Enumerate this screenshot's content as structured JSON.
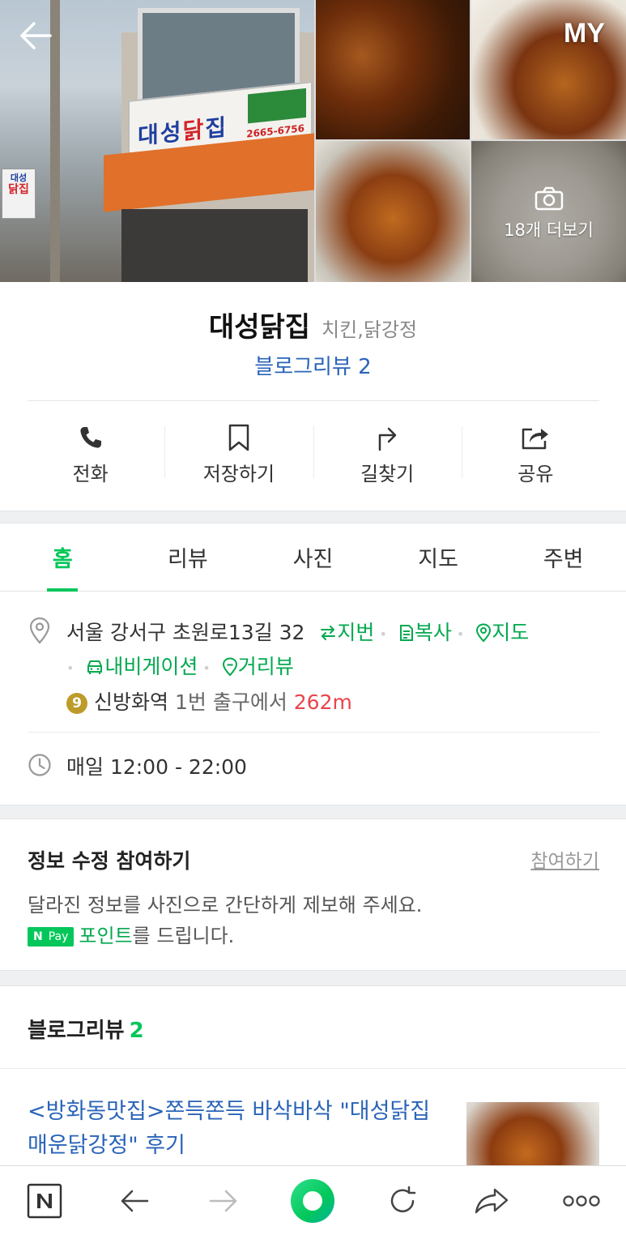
{
  "header": {
    "my_label": "MY",
    "more_photos_label": "18개 더보기"
  },
  "shop_sign": {
    "name_part1": "대성",
    "name_part2": "닭",
    "name_part3": "집",
    "phone": "2665-6756",
    "side_top": "대성",
    "side_bottom": "닭집"
  },
  "place": {
    "name": "대성닭집",
    "category": "치킨,닭강정",
    "blog_review_link": "블로그리뷰 2"
  },
  "actions": [
    {
      "label": "전화",
      "icon": "phone-icon"
    },
    {
      "label": "저장하기",
      "icon": "bookmark-icon"
    },
    {
      "label": "길찾기",
      "icon": "directions-icon"
    },
    {
      "label": "공유",
      "icon": "share-icon"
    }
  ],
  "tabs": [
    {
      "label": "홈",
      "active": true
    },
    {
      "label": "리뷰",
      "active": false
    },
    {
      "label": "사진",
      "active": false
    },
    {
      "label": "지도",
      "active": false
    },
    {
      "label": "주변",
      "active": false
    }
  ],
  "info": {
    "address": "서울 강서구 초원로13길 32",
    "lot_number_link": "지번",
    "copy_link": "복사",
    "map_link": "지도",
    "navigation_link": "내비게이션",
    "street_view_link": "거리뷰",
    "subway_line": "9",
    "subway_station": "신방화역",
    "subway_exit": "1번 출구에서",
    "subway_distance": "262m",
    "hours": "매일 12:00 - 22:00"
  },
  "edit_info": {
    "title": "정보 수정 참여하기",
    "join_link": "참여하기",
    "desc1": "달라진 정보를 사진으로 간단하게 제보해 주세요.",
    "npay_n": "N",
    "npay_pay": "Pay",
    "point_word": "포인트",
    "desc2_rest": "를 드립니다."
  },
  "blog_reviews": {
    "title": "블로그리뷰",
    "count": "2",
    "first_post_title": "<방화동맛집>쫀득쫀득 바삭바삭 \"대성닭집 매운닭강정\" 후기"
  },
  "colors": {
    "accent_green": "#03c75a",
    "link_blue": "#2a64b8",
    "distance_red": "#e8454b",
    "line9_gold": "#bd9b2a"
  },
  "toolbar_icons": [
    "naver-n-icon",
    "back-arrow-icon",
    "forward-arrow-icon",
    "green-dot-icon",
    "refresh-icon",
    "share-arrow-icon",
    "more-dots-icon"
  ]
}
